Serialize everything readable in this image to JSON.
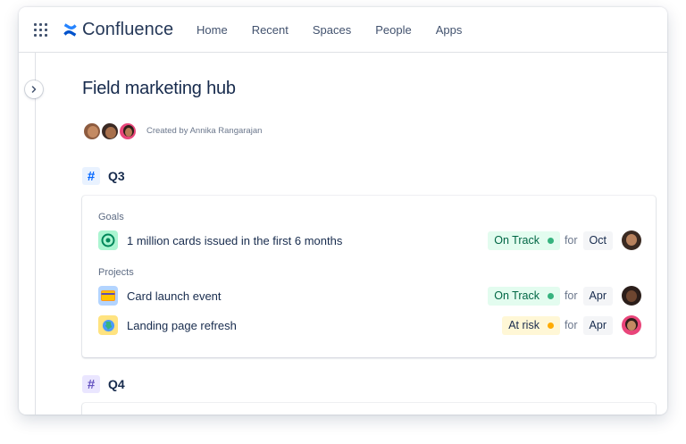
{
  "app": {
    "name": "Confluence"
  },
  "nav": {
    "items": [
      "Home",
      "Recent",
      "Spaces",
      "People",
      "Apps"
    ]
  },
  "page": {
    "title": "Field marketing hub",
    "created_by": "Created by Annika Rangarajan"
  },
  "sections": [
    {
      "label": "Q3",
      "hash_color": "#0065FF",
      "hash_bg": "#E9F2FF",
      "goals_label": "Goals",
      "goals": [
        {
          "text": "1 million cards issued in the first 6 months",
          "status": "On Track",
          "for": "for",
          "month": "Oct",
          "icon": "target-icon"
        }
      ],
      "projects_label": "Projects",
      "projects": [
        {
          "text": "Card launch event",
          "status": "On Track",
          "for": "for",
          "month": "Apr",
          "icon": "credit-card-icon"
        },
        {
          "text": "Landing page refresh",
          "status": "At risk",
          "for": "for",
          "month": "Apr",
          "icon": "globe-icon"
        }
      ]
    },
    {
      "label": "Q4",
      "hash_color": "#6554C0",
      "hash_bg": "#EAE6FF"
    }
  ],
  "colors": {
    "on_track_bg": "#E3FCEF",
    "on_track_text": "#006644",
    "on_track_dot": "#36B37E",
    "at_risk_bg": "#FFF7D6",
    "at_risk_text": "#172B4D",
    "at_risk_dot": "#FFAB00",
    "brand": "#0052CC"
  }
}
